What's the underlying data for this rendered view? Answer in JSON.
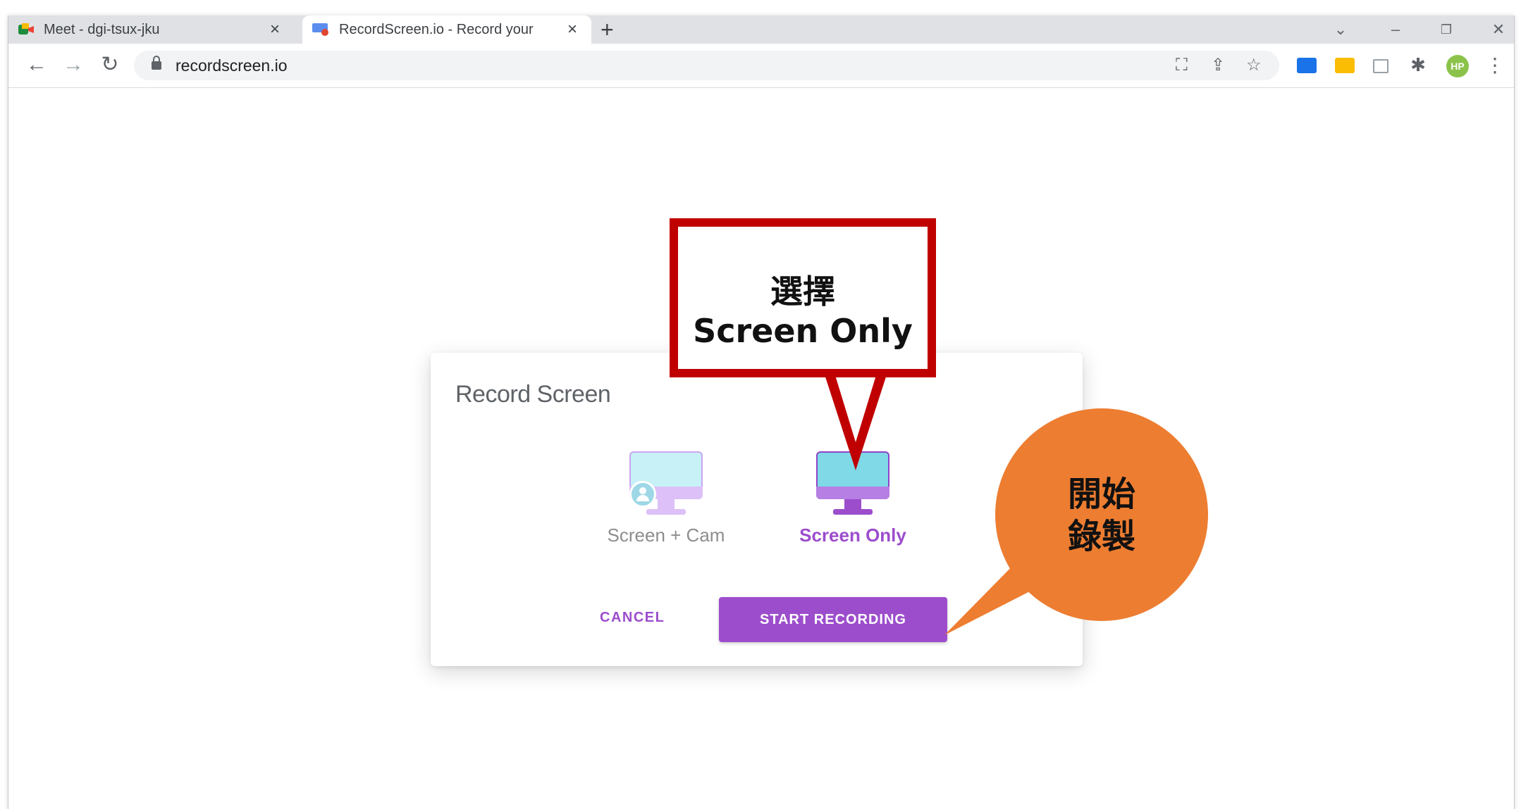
{
  "browser": {
    "tabs": [
      {
        "title": "Meet - dgi-tsux-jku",
        "active": false
      },
      {
        "title": "RecordScreen.io - Record your",
        "active": true
      }
    ],
    "tab_close_glyph": "×",
    "new_tab_glyph": "+",
    "url": "recordscreen.io",
    "avatar_initials": "HP"
  },
  "dialog": {
    "title": "Record Screen",
    "options": [
      {
        "label": "Screen + Cam",
        "selected": false
      },
      {
        "label": "Screen Only",
        "selected": true
      }
    ],
    "cancel_label": "CANCEL",
    "start_label": "START RECORDING"
  },
  "annotations": {
    "callout_line1": "選擇",
    "callout_line2": "Screen Only",
    "bubble_line1": "開始",
    "bubble_line2": "錄製"
  },
  "colors": {
    "accent": "#9c4dcc",
    "callout_border": "#c00000",
    "bubble": "#ed7d31"
  }
}
